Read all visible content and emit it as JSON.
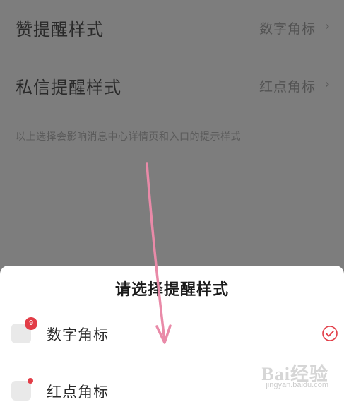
{
  "settings": {
    "rows": [
      {
        "label": "赞提醒样式",
        "value": "数字角标"
      },
      {
        "label": "私信提醒样式",
        "value": "红点角标"
      }
    ],
    "footnote": "以上选择会影响消息中心详情页和入口的提示样式"
  },
  "sheet": {
    "title": "请选择提醒样式",
    "options": [
      {
        "label": "数字角标",
        "badge": "9",
        "selected": true
      },
      {
        "label": "红点角标",
        "selected": false
      }
    ]
  },
  "watermark": {
    "brand": "Bai经验",
    "url": "jingyan.baidu.com"
  },
  "colors": {
    "accent": "#e23d47",
    "annotation_arrow": "#e98aa8"
  }
}
